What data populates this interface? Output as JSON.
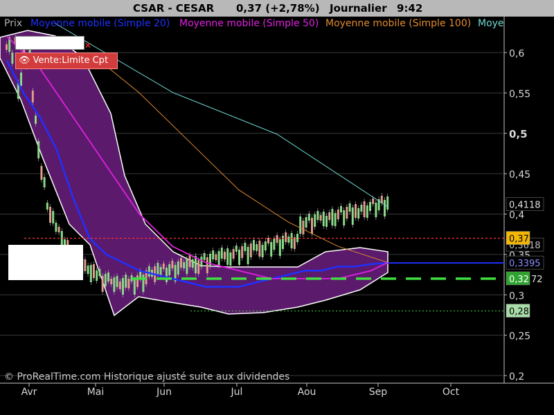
{
  "header": {
    "symbol": "CSAR - CESAR",
    "quote": "0,37 (+2,78%)",
    "period": "Journalier",
    "time": "9:42"
  },
  "legend": {
    "prix": "Prix",
    "ma20": "Moyenne mobile (Simple 20)",
    "ma50": "Moyenne mobile (Simple 50)",
    "ma100": "Moyenne mobile (Simple 100)",
    "truncated": "Moye"
  },
  "order": {
    "label": "Vente:Limite Cpt"
  },
  "footer": "© ProRealTime.com Historique ajusté suite aux dividendes",
  "price_tags": {
    "last": "0,37",
    "ma100": "0,4118",
    "ma20": "0,3395",
    "ma50_partial": "0,3618",
    "support": "0,32",
    "support_extra": "72",
    "low": "0,28"
  },
  "colors": {
    "background": "#000000",
    "band_fill": "#5b1a6b",
    "band_edge": "#ffffff",
    "ma20": "#2030ff",
    "ma50": "#e020e0",
    "ma100": "#e08a30",
    "ma200": "#70d8d0",
    "candle_up": "#7adf7a",
    "candle_down": "#e89080",
    "support": "#40e040",
    "resistance": "#ff3030"
  },
  "chart_data": {
    "type": "line",
    "x_ticks": [
      "Avr",
      "Mai",
      "Jun",
      "Jul",
      "Aou",
      "Sep",
      "Oct"
    ],
    "y_ticks": [
      "0,2",
      "0,25",
      "0,3",
      "0,35",
      "0,4",
      "0,45",
      "0,5",
      "0,55",
      "0,6"
    ],
    "y_tick_values": [
      0.2,
      0.25,
      0.3,
      0.35,
      0.4,
      0.45,
      0.5,
      0.55,
      0.6
    ],
    "ylim": [
      0.2,
      0.63
    ],
    "xlim_weeks": [
      -1,
      29
    ],
    "levels": {
      "resistance": 0.37,
      "support": 0.32,
      "low": 0.28
    },
    "series": [
      {
        "name": "Prix",
        "weeks": [
          0,
          1,
          2,
          3,
          4,
          5,
          6,
          7,
          8,
          9,
          10,
          11,
          12,
          13,
          14,
          15,
          16,
          17,
          18,
          19,
          20,
          21,
          22,
          23
        ],
        "values": [
          0.58,
          0.5,
          0.49,
          0.56,
          0.37,
          0.36,
          0.35,
          0.34,
          0.33,
          0.32,
          0.32,
          0.31,
          0.31,
          0.3,
          0.31,
          0.31,
          0.31,
          0.32,
          0.34,
          0.35,
          0.34,
          0.33,
          0.34,
          0.37
        ]
      },
      {
        "name": "Moyenne mobile (Simple 20)",
        "weeks": [
          0,
          1,
          2,
          3,
          4,
          5,
          6,
          7,
          8,
          9,
          10,
          11,
          12,
          13,
          14,
          15,
          16,
          17,
          18,
          19,
          20,
          21,
          22,
          23
        ],
        "values": [
          0.59,
          0.55,
          0.52,
          0.48,
          0.42,
          0.37,
          0.35,
          0.34,
          0.33,
          0.325,
          0.32,
          0.315,
          0.31,
          0.31,
          0.31,
          0.315,
          0.32,
          0.325,
          0.33,
          0.33,
          0.335,
          0.335,
          0.338,
          0.3395
        ]
      },
      {
        "name": "Moyenne mobile (Simple 50)",
        "weeks": [
          0,
          2,
          4,
          6,
          8,
          10,
          12,
          14,
          16,
          18,
          20,
          22,
          23
        ],
        "values": [
          0.62,
          0.58,
          0.52,
          0.46,
          0.4,
          0.36,
          0.34,
          0.33,
          0.32,
          0.32,
          0.32,
          0.33,
          0.34
        ]
      },
      {
        "name": "Moyenne mobile (Simple 100)",
        "weeks": [
          5,
          8,
          11,
          14,
          17,
          20,
          23
        ],
        "values": [
          0.6,
          0.55,
          0.49,
          0.43,
          0.39,
          0.36,
          0.34
        ]
      }
    ]
  }
}
